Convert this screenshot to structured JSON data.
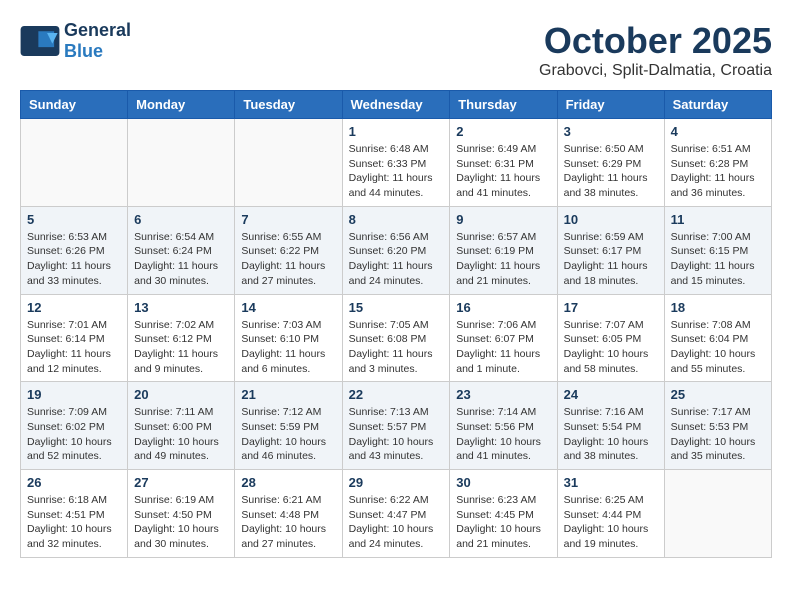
{
  "header": {
    "logo_line1": "General",
    "logo_line2": "Blue",
    "month": "October 2025",
    "location": "Grabovci, Split-Dalmatia, Croatia"
  },
  "weekdays": [
    "Sunday",
    "Monday",
    "Tuesday",
    "Wednesday",
    "Thursday",
    "Friday",
    "Saturday"
  ],
  "weeks": [
    [
      {
        "day": "",
        "info": ""
      },
      {
        "day": "",
        "info": ""
      },
      {
        "day": "",
        "info": ""
      },
      {
        "day": "1",
        "info": "Sunrise: 6:48 AM\nSunset: 6:33 PM\nDaylight: 11 hours\nand 44 minutes."
      },
      {
        "day": "2",
        "info": "Sunrise: 6:49 AM\nSunset: 6:31 PM\nDaylight: 11 hours\nand 41 minutes."
      },
      {
        "day": "3",
        "info": "Sunrise: 6:50 AM\nSunset: 6:29 PM\nDaylight: 11 hours\nand 38 minutes."
      },
      {
        "day": "4",
        "info": "Sunrise: 6:51 AM\nSunset: 6:28 PM\nDaylight: 11 hours\nand 36 minutes."
      }
    ],
    [
      {
        "day": "5",
        "info": "Sunrise: 6:53 AM\nSunset: 6:26 PM\nDaylight: 11 hours\nand 33 minutes."
      },
      {
        "day": "6",
        "info": "Sunrise: 6:54 AM\nSunset: 6:24 PM\nDaylight: 11 hours\nand 30 minutes."
      },
      {
        "day": "7",
        "info": "Sunrise: 6:55 AM\nSunset: 6:22 PM\nDaylight: 11 hours\nand 27 minutes."
      },
      {
        "day": "8",
        "info": "Sunrise: 6:56 AM\nSunset: 6:20 PM\nDaylight: 11 hours\nand 24 minutes."
      },
      {
        "day": "9",
        "info": "Sunrise: 6:57 AM\nSunset: 6:19 PM\nDaylight: 11 hours\nand 21 minutes."
      },
      {
        "day": "10",
        "info": "Sunrise: 6:59 AM\nSunset: 6:17 PM\nDaylight: 11 hours\nand 18 minutes."
      },
      {
        "day": "11",
        "info": "Sunrise: 7:00 AM\nSunset: 6:15 PM\nDaylight: 11 hours\nand 15 minutes."
      }
    ],
    [
      {
        "day": "12",
        "info": "Sunrise: 7:01 AM\nSunset: 6:14 PM\nDaylight: 11 hours\nand 12 minutes."
      },
      {
        "day": "13",
        "info": "Sunrise: 7:02 AM\nSunset: 6:12 PM\nDaylight: 11 hours\nand 9 minutes."
      },
      {
        "day": "14",
        "info": "Sunrise: 7:03 AM\nSunset: 6:10 PM\nDaylight: 11 hours\nand 6 minutes."
      },
      {
        "day": "15",
        "info": "Sunrise: 7:05 AM\nSunset: 6:08 PM\nDaylight: 11 hours\nand 3 minutes."
      },
      {
        "day": "16",
        "info": "Sunrise: 7:06 AM\nSunset: 6:07 PM\nDaylight: 11 hours\nand 1 minute."
      },
      {
        "day": "17",
        "info": "Sunrise: 7:07 AM\nSunset: 6:05 PM\nDaylight: 10 hours\nand 58 minutes."
      },
      {
        "day": "18",
        "info": "Sunrise: 7:08 AM\nSunset: 6:04 PM\nDaylight: 10 hours\nand 55 minutes."
      }
    ],
    [
      {
        "day": "19",
        "info": "Sunrise: 7:09 AM\nSunset: 6:02 PM\nDaylight: 10 hours\nand 52 minutes."
      },
      {
        "day": "20",
        "info": "Sunrise: 7:11 AM\nSunset: 6:00 PM\nDaylight: 10 hours\nand 49 minutes."
      },
      {
        "day": "21",
        "info": "Sunrise: 7:12 AM\nSunset: 5:59 PM\nDaylight: 10 hours\nand 46 minutes."
      },
      {
        "day": "22",
        "info": "Sunrise: 7:13 AM\nSunset: 5:57 PM\nDaylight: 10 hours\nand 43 minutes."
      },
      {
        "day": "23",
        "info": "Sunrise: 7:14 AM\nSunset: 5:56 PM\nDaylight: 10 hours\nand 41 minutes."
      },
      {
        "day": "24",
        "info": "Sunrise: 7:16 AM\nSunset: 5:54 PM\nDaylight: 10 hours\nand 38 minutes."
      },
      {
        "day": "25",
        "info": "Sunrise: 7:17 AM\nSunset: 5:53 PM\nDaylight: 10 hours\nand 35 minutes."
      }
    ],
    [
      {
        "day": "26",
        "info": "Sunrise: 6:18 AM\nSunset: 4:51 PM\nDaylight: 10 hours\nand 32 minutes."
      },
      {
        "day": "27",
        "info": "Sunrise: 6:19 AM\nSunset: 4:50 PM\nDaylight: 10 hours\nand 30 minutes."
      },
      {
        "day": "28",
        "info": "Sunrise: 6:21 AM\nSunset: 4:48 PM\nDaylight: 10 hours\nand 27 minutes."
      },
      {
        "day": "29",
        "info": "Sunrise: 6:22 AM\nSunset: 4:47 PM\nDaylight: 10 hours\nand 24 minutes."
      },
      {
        "day": "30",
        "info": "Sunrise: 6:23 AM\nSunset: 4:45 PM\nDaylight: 10 hours\nand 21 minutes."
      },
      {
        "day": "31",
        "info": "Sunrise: 6:25 AM\nSunset: 4:44 PM\nDaylight: 10 hours\nand 19 minutes."
      },
      {
        "day": "",
        "info": ""
      }
    ]
  ]
}
